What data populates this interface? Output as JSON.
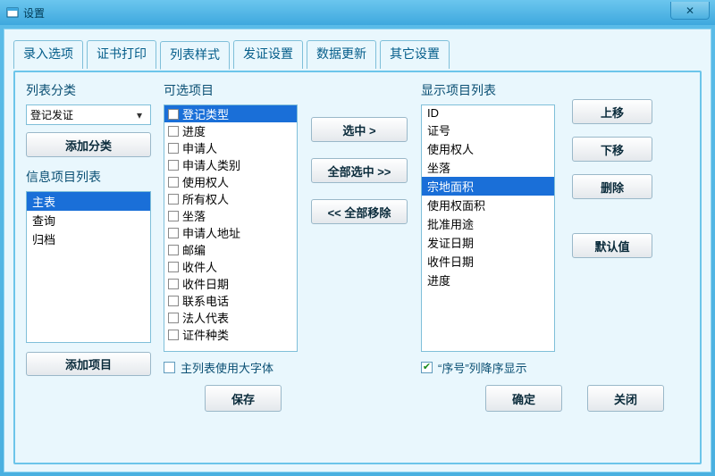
{
  "window": {
    "title": "设置"
  },
  "tabs": [
    {
      "label": "录入选项"
    },
    {
      "label": "证书打印"
    },
    {
      "label": "列表样式",
      "active": true
    },
    {
      "label": "发证设置"
    },
    {
      "label": "数据更新"
    },
    {
      "label": "其它设置"
    }
  ],
  "left": {
    "category_label": "列表分类",
    "combo_value": "登记发证",
    "add_category_label": "添加分类",
    "info_list_label": "信息项目列表",
    "info_items": [
      {
        "label": "主表",
        "selected": true
      },
      {
        "label": "查询"
      },
      {
        "label": "归档"
      }
    ],
    "add_item_label": "添加项目"
  },
  "available": {
    "label": "可选项目",
    "items": [
      {
        "label": "登记类型",
        "selected": true
      },
      {
        "label": "进度"
      },
      {
        "label": "申请人"
      },
      {
        "label": "申请人类别"
      },
      {
        "label": "使用权人"
      },
      {
        "label": "所有权人"
      },
      {
        "label": "坐落"
      },
      {
        "label": "申请人地址"
      },
      {
        "label": "邮编"
      },
      {
        "label": "收件人"
      },
      {
        "label": "收件日期"
      },
      {
        "label": "联系电话"
      },
      {
        "label": "法人代表"
      },
      {
        "label": "证件种类"
      }
    ],
    "big_font_label": "主列表使用大字体",
    "big_font_checked": false
  },
  "mid": {
    "select_label": "选中 >",
    "select_all_label": "全部选中 >>",
    "remove_all_label": "<< 全部移除"
  },
  "display": {
    "label": "显示项目列表",
    "items": [
      {
        "label": "ID"
      },
      {
        "label": "证号"
      },
      {
        "label": "使用权人"
      },
      {
        "label": "坐落"
      },
      {
        "label": "宗地面积",
        "selected": true
      },
      {
        "label": "使用权面积"
      },
      {
        "label": "批准用途"
      },
      {
        "label": "发证日期"
      },
      {
        "label": "收件日期"
      },
      {
        "label": "进度"
      }
    ],
    "order_desc_label": "“序号”列降序显示",
    "order_desc_checked": true
  },
  "right": {
    "move_up_label": "上移",
    "move_down_label": "下移",
    "delete_label": "删除",
    "default_label": "默认值"
  },
  "footer": {
    "save_label": "保存",
    "ok_label": "确定",
    "close_label": "关闭"
  }
}
